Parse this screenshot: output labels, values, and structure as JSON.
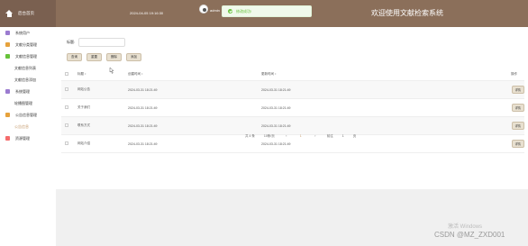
{
  "header": {
    "brand": "后台首页",
    "datetime": "2024-04-05 19:16:30",
    "username": "admin",
    "title": "欢迎使用文献检索系统"
  },
  "toast": {
    "message": "修改成功!"
  },
  "sidebar": {
    "items": [
      {
        "label": "系统用户",
        "icon": "user-icon",
        "type": "group"
      },
      {
        "label": "文献分类管理",
        "icon": "book-icon",
        "type": "group"
      },
      {
        "label": "文献信息管理",
        "icon": "doc-icon",
        "type": "group"
      },
      {
        "label": "文献信息列表",
        "type": "sub"
      },
      {
        "label": "文献信息添加",
        "type": "sub"
      },
      {
        "label": "系统管理",
        "icon": "gear-icon",
        "type": "group"
      },
      {
        "label": "轮播图管理",
        "type": "sub"
      },
      {
        "label": "公告信息管理",
        "icon": "bell-icon",
        "type": "group"
      },
      {
        "label": "公告信息",
        "type": "sub",
        "active": true
      },
      {
        "label": "资源管理",
        "icon": "resource-icon",
        "type": "group"
      }
    ]
  },
  "search": {
    "label": "标题:",
    "placeholder": ""
  },
  "buttons": {
    "query": "查询",
    "reset": "重置",
    "delete": "删除",
    "add": "添加"
  },
  "table": {
    "headers": {
      "title": "标题 ↕",
      "created": "创建时间 ↕",
      "updated": "更新时间 ↕",
      "op": "操作"
    },
    "rows": [
      {
        "title": "网站公告",
        "created": "2024-03-31 18:21:49",
        "updated": "2024-03-31 18:21:49",
        "action": "详情"
      },
      {
        "title": "关于我们",
        "created": "2024-03-31 18:21:49",
        "updated": "2024-03-31 18:21:49",
        "action": "详情"
      },
      {
        "title": "联系方式",
        "created": "2024-03-31 18:21:49",
        "updated": "2024-03-31 18:21:49",
        "action": "详情"
      },
      {
        "title": "网站介绍",
        "created": "2024-03-31 18:21:49",
        "updated": "2024-03-31 18:21:49",
        "action": "详情"
      }
    ]
  },
  "pagination": {
    "total": "共 4 条",
    "page_size": "10条/页",
    "prev": "‹",
    "current": "1",
    "next": "›",
    "goto_label": "前往",
    "goto_value": "1",
    "page_suffix": "页"
  },
  "watermark": {
    "activate": "激活 Windows",
    "csdn": "CSDN @MZ_ZXD001"
  },
  "colors": {
    "header": "#8b6f5a",
    "accent": "#c49a6c",
    "success": "#67c23a"
  }
}
